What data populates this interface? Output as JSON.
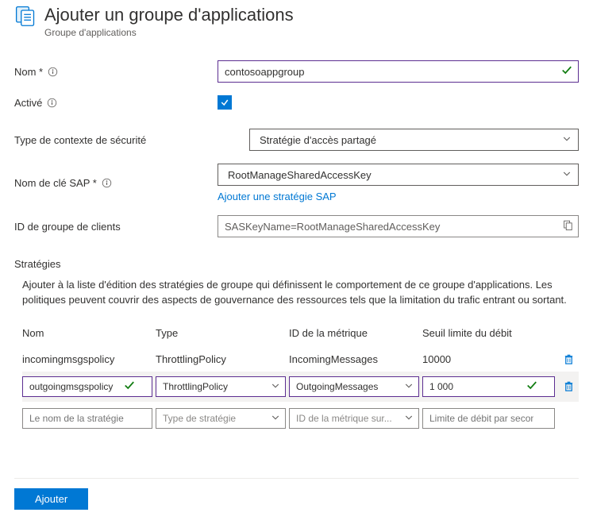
{
  "header": {
    "title": "Ajouter un groupe d'applications",
    "subtitle": "Groupe d'applications"
  },
  "form": {
    "name_label": "Nom *",
    "name_value": "contosoappgroup",
    "enabled_label": "Activé",
    "context_label": "Type de contexte de sécurité",
    "context_value": "Stratégie d'accès partagé",
    "sas_label": "Nom de clé SAP *",
    "sas_value": "RootManageSharedAccessKey",
    "sas_link": "Ajouter une stratégie SAP",
    "group_id_label": "ID de groupe de clients",
    "group_id_value": "SASKeyName=RootManageSharedAccessKey"
  },
  "policies": {
    "section_title": "Stratégies",
    "description": "Ajouter à la liste d'édition des stratégies de groupe qui définissent le comportement de ce groupe d'applications. Les politiques peuvent couvrir des aspects de gouvernance des ressources tels que la limitation du trafic entrant ou sortant.",
    "headers": {
      "name": "Nom",
      "type": "Type",
      "metric": "ID de la métrique",
      "threshold": "Seuil limite du débit"
    },
    "static_row": {
      "name": "incomingmsgspolicy",
      "type": "ThrottlingPolicy",
      "metric": "IncomingMessages",
      "threshold": "10000"
    },
    "edit_row": {
      "name": "outgoingmsgspolicy",
      "type": "ThrottlingPolicy",
      "metric": "OutgoingMessages",
      "threshold": "1 000"
    },
    "blank_row": {
      "name_ph": "Le nom de la stratégie",
      "type_ph": "Type de stratégie",
      "metric_ph": "ID de la métrique sur...",
      "threshold_ph": "Limite de débit par seconde"
    }
  },
  "footer": {
    "submit": "Ajouter"
  }
}
